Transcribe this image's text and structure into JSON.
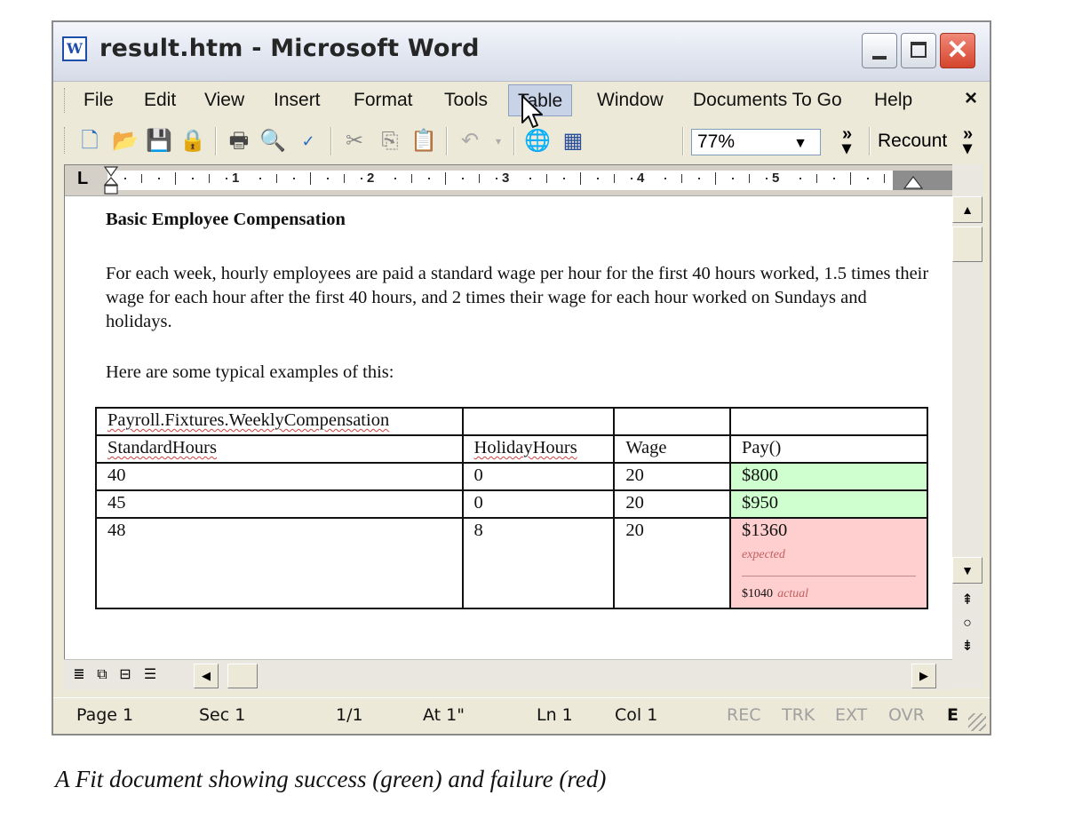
{
  "window": {
    "icon": "word-app-icon",
    "title": "result.htm - Microsoft Word",
    "controls": {
      "minimize": "minimize-icon",
      "maximize": "maximize-icon",
      "close": "✕"
    }
  },
  "menu": {
    "items": [
      "File",
      "Edit",
      "View",
      "Insert",
      "Format",
      "Tools",
      "Table",
      "Window",
      "Documents To Go",
      "Help"
    ],
    "active": "Table",
    "close": "×"
  },
  "toolbar": {
    "zoom": "77%",
    "recount": "Recount",
    "icons": [
      "new-doc-icon",
      "open-folder-icon",
      "save-icon",
      "permission-icon",
      "print-icon",
      "print-preview-icon",
      "spelling-icon",
      "cut-icon",
      "copy-icon",
      "paste-icon",
      "undo-icon",
      "hyperlink-icon",
      "insert-table-icon"
    ]
  },
  "ruler": {
    "tab_marker": "L",
    "numbers": [
      "1",
      "2",
      "3",
      "4",
      "5"
    ]
  },
  "document": {
    "heading": "Basic Employee Compensation",
    "paragraph": "For each week, hourly employees are paid a standard wage per hour for the first 40 hours worked, 1.5 times their wage for each hour after the first 40 hours, and 2 times their wage for each hour worked on Sundays and holidays.",
    "intro": "Here are some typical examples of this:",
    "table": {
      "fixture": "Payroll.Fixtures.WeeklyCompensation",
      "headers": [
        "StandardHours",
        "HolidayHours",
        "Wage",
        "Pay()"
      ],
      "rows": [
        {
          "cells": [
            "40",
            "0",
            "20",
            "$800"
          ],
          "status": "pass"
        },
        {
          "cells": [
            "45",
            "0",
            "20",
            "$950"
          ],
          "status": "pass"
        },
        {
          "cells": [
            "48",
            "8",
            "20",
            "$1360"
          ],
          "status": "fail",
          "expected_label": "expected",
          "actual_value": "$1040",
          "actual_label": "actual"
        }
      ]
    }
  },
  "statusbar": {
    "page": "Page 1",
    "sec": "Sec 1",
    "pages": "1/1",
    "at": "At 1\"",
    "ln": "Ln 1",
    "col": "Col 1",
    "rec": "REC",
    "trk": "TRK",
    "ext": "EXT",
    "ovr": "OVR",
    "lang": "E"
  },
  "colors": {
    "pass": "#cfffcf",
    "fail": "#ffcfcf",
    "chrome": "#ece9d8"
  },
  "caption": "A Fit document showing success (green) and failure (red)"
}
